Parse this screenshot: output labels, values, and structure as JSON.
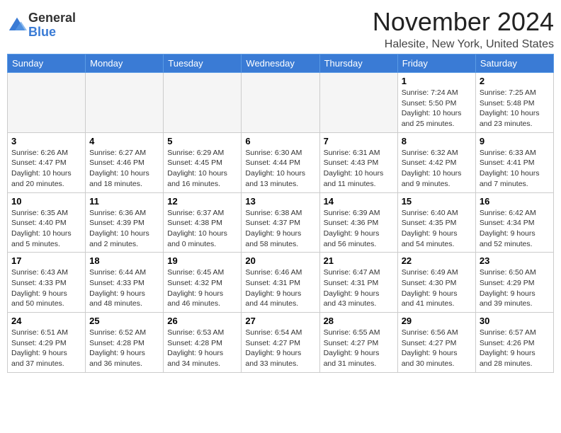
{
  "logo": {
    "general": "General",
    "blue": "Blue"
  },
  "title": "November 2024",
  "location": "Halesite, New York, United States",
  "days_of_week": [
    "Sunday",
    "Monday",
    "Tuesday",
    "Wednesday",
    "Thursday",
    "Friday",
    "Saturday"
  ],
  "weeks": [
    [
      {
        "day": "",
        "info": ""
      },
      {
        "day": "",
        "info": ""
      },
      {
        "day": "",
        "info": ""
      },
      {
        "day": "",
        "info": ""
      },
      {
        "day": "",
        "info": ""
      },
      {
        "day": "1",
        "info": "Sunrise: 7:24 AM\nSunset: 5:50 PM\nDaylight: 10 hours and 25 minutes."
      },
      {
        "day": "2",
        "info": "Sunrise: 7:25 AM\nSunset: 5:48 PM\nDaylight: 10 hours and 23 minutes."
      }
    ],
    [
      {
        "day": "3",
        "info": "Sunrise: 6:26 AM\nSunset: 4:47 PM\nDaylight: 10 hours and 20 minutes."
      },
      {
        "day": "4",
        "info": "Sunrise: 6:27 AM\nSunset: 4:46 PM\nDaylight: 10 hours and 18 minutes."
      },
      {
        "day": "5",
        "info": "Sunrise: 6:29 AM\nSunset: 4:45 PM\nDaylight: 10 hours and 16 minutes."
      },
      {
        "day": "6",
        "info": "Sunrise: 6:30 AM\nSunset: 4:44 PM\nDaylight: 10 hours and 13 minutes."
      },
      {
        "day": "7",
        "info": "Sunrise: 6:31 AM\nSunset: 4:43 PM\nDaylight: 10 hours and 11 minutes."
      },
      {
        "day": "8",
        "info": "Sunrise: 6:32 AM\nSunset: 4:42 PM\nDaylight: 10 hours and 9 minutes."
      },
      {
        "day": "9",
        "info": "Sunrise: 6:33 AM\nSunset: 4:41 PM\nDaylight: 10 hours and 7 minutes."
      }
    ],
    [
      {
        "day": "10",
        "info": "Sunrise: 6:35 AM\nSunset: 4:40 PM\nDaylight: 10 hours and 5 minutes."
      },
      {
        "day": "11",
        "info": "Sunrise: 6:36 AM\nSunset: 4:39 PM\nDaylight: 10 hours and 2 minutes."
      },
      {
        "day": "12",
        "info": "Sunrise: 6:37 AM\nSunset: 4:38 PM\nDaylight: 10 hours and 0 minutes."
      },
      {
        "day": "13",
        "info": "Sunrise: 6:38 AM\nSunset: 4:37 PM\nDaylight: 9 hours and 58 minutes."
      },
      {
        "day": "14",
        "info": "Sunrise: 6:39 AM\nSunset: 4:36 PM\nDaylight: 9 hours and 56 minutes."
      },
      {
        "day": "15",
        "info": "Sunrise: 6:40 AM\nSunset: 4:35 PM\nDaylight: 9 hours and 54 minutes."
      },
      {
        "day": "16",
        "info": "Sunrise: 6:42 AM\nSunset: 4:34 PM\nDaylight: 9 hours and 52 minutes."
      }
    ],
    [
      {
        "day": "17",
        "info": "Sunrise: 6:43 AM\nSunset: 4:33 PM\nDaylight: 9 hours and 50 minutes."
      },
      {
        "day": "18",
        "info": "Sunrise: 6:44 AM\nSunset: 4:33 PM\nDaylight: 9 hours and 48 minutes."
      },
      {
        "day": "19",
        "info": "Sunrise: 6:45 AM\nSunset: 4:32 PM\nDaylight: 9 hours and 46 minutes."
      },
      {
        "day": "20",
        "info": "Sunrise: 6:46 AM\nSunset: 4:31 PM\nDaylight: 9 hours and 44 minutes."
      },
      {
        "day": "21",
        "info": "Sunrise: 6:47 AM\nSunset: 4:31 PM\nDaylight: 9 hours and 43 minutes."
      },
      {
        "day": "22",
        "info": "Sunrise: 6:49 AM\nSunset: 4:30 PM\nDaylight: 9 hours and 41 minutes."
      },
      {
        "day": "23",
        "info": "Sunrise: 6:50 AM\nSunset: 4:29 PM\nDaylight: 9 hours and 39 minutes."
      }
    ],
    [
      {
        "day": "24",
        "info": "Sunrise: 6:51 AM\nSunset: 4:29 PM\nDaylight: 9 hours and 37 minutes."
      },
      {
        "day": "25",
        "info": "Sunrise: 6:52 AM\nSunset: 4:28 PM\nDaylight: 9 hours and 36 minutes."
      },
      {
        "day": "26",
        "info": "Sunrise: 6:53 AM\nSunset: 4:28 PM\nDaylight: 9 hours and 34 minutes."
      },
      {
        "day": "27",
        "info": "Sunrise: 6:54 AM\nSunset: 4:27 PM\nDaylight: 9 hours and 33 minutes."
      },
      {
        "day": "28",
        "info": "Sunrise: 6:55 AM\nSunset: 4:27 PM\nDaylight: 9 hours and 31 minutes."
      },
      {
        "day": "29",
        "info": "Sunrise: 6:56 AM\nSunset: 4:27 PM\nDaylight: 9 hours and 30 minutes."
      },
      {
        "day": "30",
        "info": "Sunrise: 6:57 AM\nSunset: 4:26 PM\nDaylight: 9 hours and 28 minutes."
      }
    ]
  ]
}
